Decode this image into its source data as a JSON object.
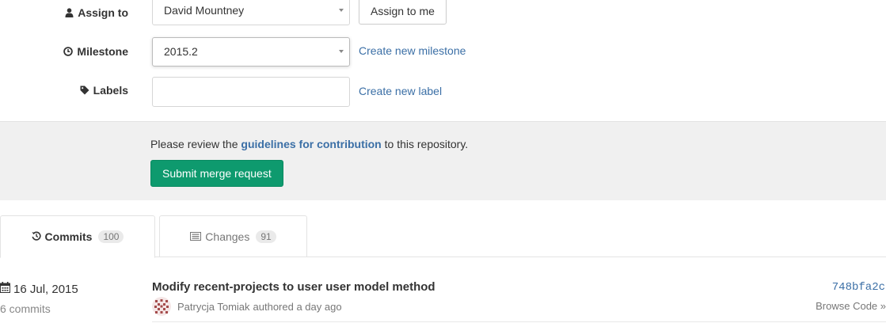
{
  "form": {
    "assignee": {
      "label": "Assign to",
      "icon": "user-icon",
      "value": "David Mountney",
      "action_label": "Assign to me"
    },
    "milestone": {
      "label": "Milestone",
      "icon": "clock-icon",
      "value": "2015.2",
      "link_label": "Create new milestone"
    },
    "labels": {
      "label": "Labels",
      "icon": "tag-icon",
      "value": "",
      "link_label": "Create new label"
    }
  },
  "review": {
    "text_before": "Please review the ",
    "link_label": "guidelines for contribution",
    "text_after": " to this repository.",
    "submit_label": "Submit merge request",
    "submit_color": "#0e9a6e"
  },
  "tabs": [
    {
      "label": "Commits",
      "icon": "history-icon",
      "count": "100",
      "active": true
    },
    {
      "label": "Changes",
      "icon": "list-icon",
      "count": "91",
      "active": false
    }
  ],
  "commits": {
    "date": "16 Jul, 2015",
    "date_icon": "calendar-icon",
    "count_label": "6 commits",
    "items": [
      {
        "title": "Modify recent-projects to user user model method",
        "author": "Patrycja Tomiak",
        "meta": "authored a day ago",
        "sha": "748bfa2c",
        "browse_label": "Browse Code »"
      }
    ]
  },
  "colors": {
    "link": "#3b6fa6",
    "panel_bg": "#f0f0f0",
    "accent_green": "#0e9a6e"
  }
}
